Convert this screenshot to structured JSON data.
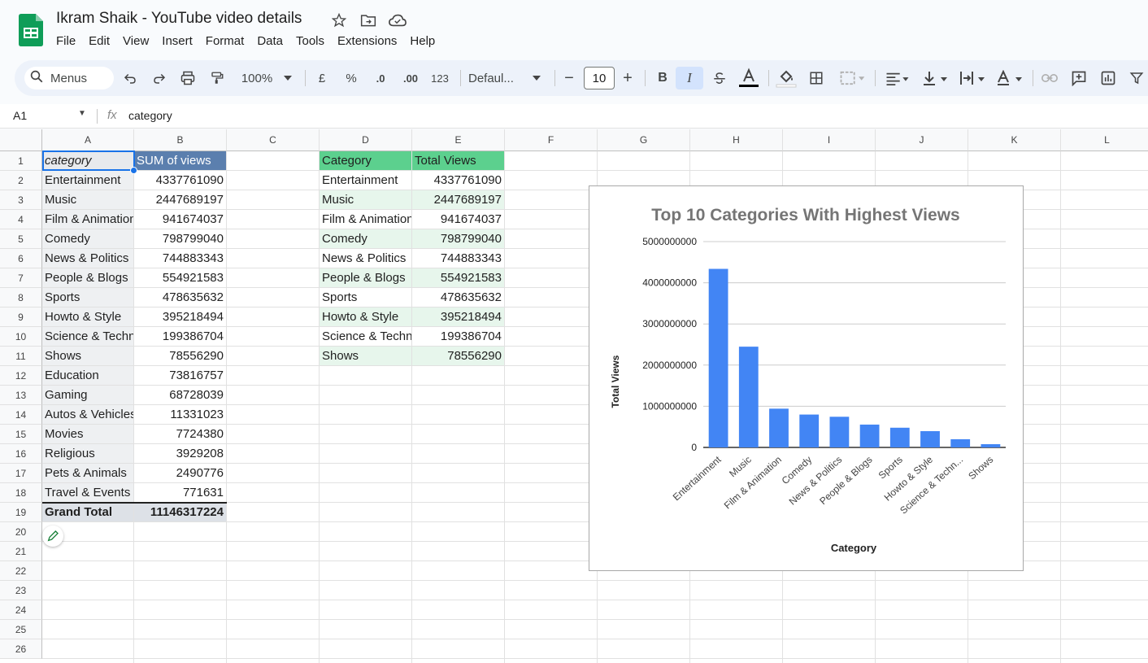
{
  "app": {
    "title": "Ikram Shaik - YouTube video details",
    "menu": [
      "File",
      "Edit",
      "View",
      "Insert",
      "Format",
      "Data",
      "Tools",
      "Extensions",
      "Help"
    ]
  },
  "toolbar": {
    "search_label": "Menus",
    "zoom": "100%",
    "currency": "£",
    "percent": "%",
    "dec_decrease": ".0",
    "dec_increase": ".00",
    "number_format": "123",
    "font": "Defaul...",
    "font_size": "10",
    "bold": "B",
    "italic": "I",
    "minus": "−",
    "plus": "+"
  },
  "formula_bar": {
    "cell_ref": "A1",
    "fx": "fx",
    "content": "category"
  },
  "columns": [
    "A",
    "B",
    "C",
    "D",
    "E",
    "F",
    "G",
    "H",
    "I",
    "J",
    "K",
    "L"
  ],
  "rows": [
    "1",
    "2",
    "3",
    "4",
    "5",
    "6",
    "7",
    "8",
    "9",
    "10",
    "11",
    "12",
    "13",
    "14",
    "15",
    "16",
    "17",
    "18",
    "19",
    "20",
    "21",
    "22",
    "23",
    "24",
    "25",
    "26"
  ],
  "pivot": {
    "header": [
      "category",
      "SUM of views"
    ],
    "rows": [
      [
        "Entertainment",
        "4337761090"
      ],
      [
        "Music",
        "2447689197"
      ],
      [
        "Film & Animation",
        "941674037"
      ],
      [
        "Comedy",
        "798799040"
      ],
      [
        "News & Politics",
        "744883343"
      ],
      [
        "People & Blogs",
        "554921583"
      ],
      [
        "Sports",
        "478635632"
      ],
      [
        "Howto & Style",
        "395218494"
      ],
      [
        "Science & Technology",
        "199386704"
      ],
      [
        "Shows",
        "78556290"
      ],
      [
        "Education",
        "73816757"
      ],
      [
        "Gaming",
        "68728039"
      ],
      [
        "Autos & Vehicles",
        "11331023"
      ],
      [
        "Movies",
        "7724380"
      ],
      [
        "Religious",
        "3929208"
      ],
      [
        "Pets & Animals",
        "2490776"
      ],
      [
        "Travel & Events",
        "771631"
      ]
    ],
    "total": [
      "Grand Total",
      "11146317224"
    ]
  },
  "top10": {
    "header": [
      "Category",
      "Total Views"
    ],
    "rows": [
      [
        "Entertainment",
        "4337761090"
      ],
      [
        "Music",
        "2447689197"
      ],
      [
        "Film & Animation",
        "941674037"
      ],
      [
        "Comedy",
        "798799040"
      ],
      [
        "News & Politics",
        "744883343"
      ],
      [
        "People & Blogs",
        "554921583"
      ],
      [
        "Sports",
        "478635632"
      ],
      [
        "Howto & Style",
        "395218494"
      ],
      [
        "Science & Technology",
        "199386704"
      ],
      [
        "Shows",
        "78556290"
      ]
    ]
  },
  "colors": {
    "header_green": "#5cd08e",
    "band_green": "#e7f6ec",
    "pivot_header": "#5b7fae",
    "pivot_band": "#eef0f2",
    "bar": "#4285f4"
  },
  "chart_data": {
    "type": "bar",
    "title": "Top 10 Categories With Highest Views",
    "xlabel": "Category",
    "ylabel": "Total Views",
    "categories": [
      "Entertainment",
      "Music",
      "Film & Animation",
      "Comedy",
      "News & Politics",
      "People & Blogs",
      "Sports",
      "Howto & Style",
      "Science & Techn...",
      "Shows"
    ],
    "values": [
      4337761090,
      2447689197,
      941674037,
      798799040,
      744883343,
      554921583,
      478635632,
      395218494,
      199386704,
      78556290
    ],
    "yticks": [
      "0",
      "1000000000",
      "2000000000",
      "3000000000",
      "4000000000",
      "5000000000"
    ],
    "ylim": [
      0,
      5000000000
    ],
    "grid": true
  }
}
